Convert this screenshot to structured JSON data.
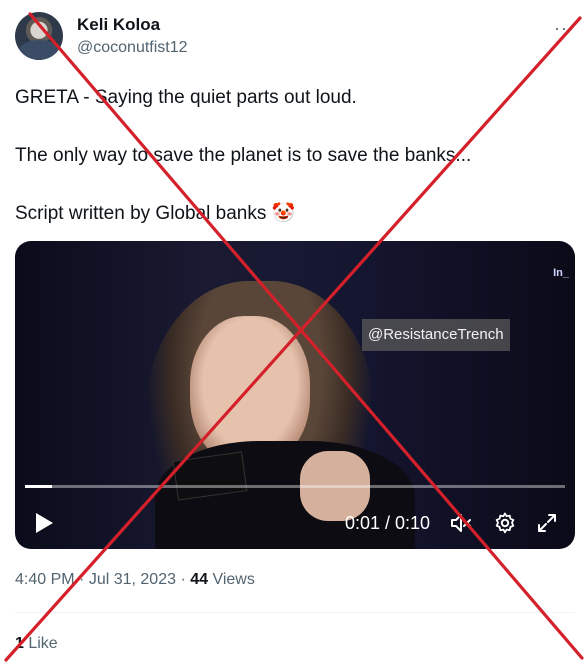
{
  "tweet": {
    "author": {
      "display_name": "Keli Koloa",
      "handle": "@coconutfist12"
    },
    "more_icon": "more-options-icon",
    "lines": [
      "GRETA - Saying the quiet parts out loud.",
      "The only way to save the planet is to save the banks...",
      "Script written by Global banks"
    ],
    "emoji": "🤡",
    "video": {
      "watermark": "@ResistanceTrench",
      "corner_logo": "In_",
      "time": "0:01 / 0:10",
      "progress": 0.05
    },
    "meta": {
      "time": "4:40 PM",
      "separator1": " · ",
      "date": "Jul 31, 2023",
      "separator2": " · ",
      "views_count": "44",
      "views_label": " Views"
    },
    "likes": {
      "count": "1",
      "label": " Like"
    }
  },
  "overlay": {
    "cross_color": "#d4202a"
  }
}
